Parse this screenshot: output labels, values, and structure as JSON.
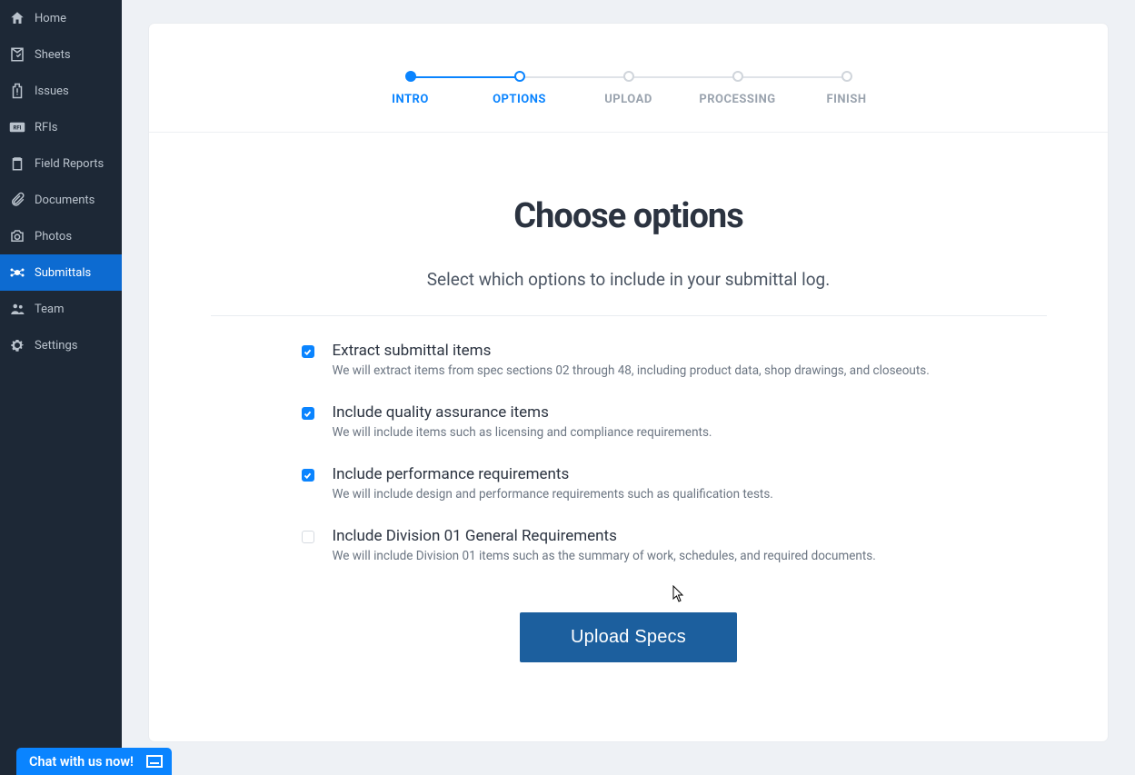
{
  "sidebar": {
    "items": [
      {
        "label": "Home",
        "icon": "home-icon"
      },
      {
        "label": "Sheets",
        "icon": "sheets-icon"
      },
      {
        "label": "Issues",
        "icon": "issues-icon"
      },
      {
        "label": "RFIs",
        "icon": "rfi-icon"
      },
      {
        "label": "Field Reports",
        "icon": "clipboard-icon"
      },
      {
        "label": "Documents",
        "icon": "attachment-icon"
      },
      {
        "label": "Photos",
        "icon": "camera-icon"
      },
      {
        "label": "Submittals",
        "icon": "submittals-icon",
        "active": true
      },
      {
        "label": "Team",
        "icon": "team-icon"
      },
      {
        "label": "Settings",
        "icon": "gear-icon"
      }
    ]
  },
  "stepper": {
    "steps": [
      {
        "label": "INTRO",
        "state": "done"
      },
      {
        "label": "OPTIONS",
        "state": "current"
      },
      {
        "label": "UPLOAD",
        "state": "todo"
      },
      {
        "label": "PROCESSING",
        "state": "todo"
      },
      {
        "label": "FINISH",
        "state": "todo"
      }
    ]
  },
  "content": {
    "title": "Choose options",
    "subtitle": "Select which options to include in your submittal log.",
    "options": [
      {
        "checked": true,
        "title": "Extract submittal items",
        "desc": "We will extract items from spec sections 02 through 48, including product data, shop drawings, and closeouts."
      },
      {
        "checked": true,
        "title": "Include quality assurance items",
        "desc": "We will include items such as licensing and compliance requirements."
      },
      {
        "checked": true,
        "title": "Include performance requirements",
        "desc": "We will include design and performance requirements such as qualification tests."
      },
      {
        "checked": false,
        "title": "Include Division 01 General Requirements",
        "desc": "We will include Division 01 items such as the summary of work, schedules, and required documents."
      }
    ],
    "primary_button": "Upload Specs"
  },
  "chat": {
    "label": "Chat with us now!"
  },
  "colors": {
    "accent": "#0a84ff",
    "sidebar_bg": "#1d2836",
    "button_bg": "#1c5f9e"
  }
}
